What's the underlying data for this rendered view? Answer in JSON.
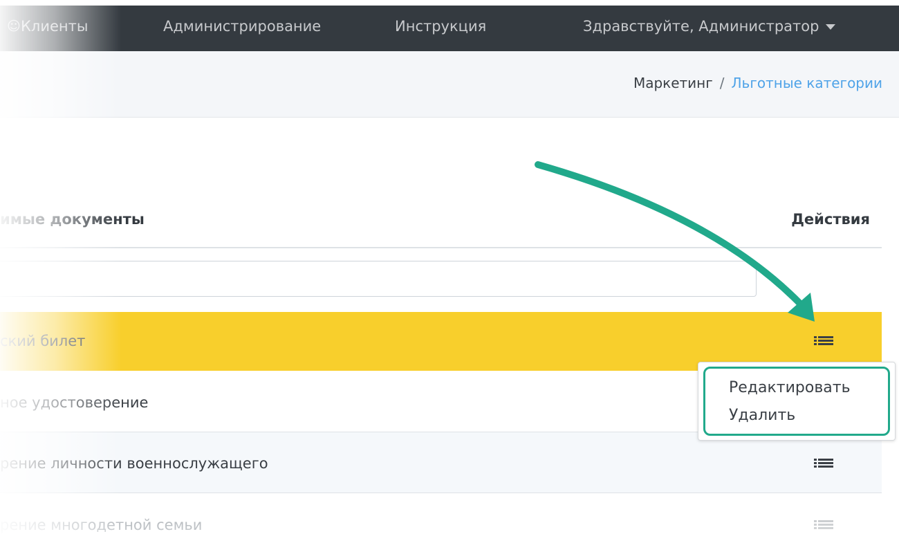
{
  "navbar": {
    "clients": "Клиенты",
    "admin": "Администрирование",
    "help": "Инструкция",
    "greeting": "Здравствуйте, Администратор"
  },
  "breadcrumb": {
    "parent": "Маркетинг",
    "separator": "/",
    "current": "Льготные категории"
  },
  "table": {
    "col_docs": "имые документы",
    "col_actions": "Действия",
    "rows": [
      {
        "label": "ский билет",
        "highlighted": true
      },
      {
        "label": "ное удостоверение"
      },
      {
        "label": "рение личности военнослужащего"
      },
      {
        "label": "рение многодетной семьи"
      }
    ]
  },
  "dropdown": {
    "edit": "Редактировать",
    "delete": "Удалить"
  },
  "colors": {
    "navbar": "#343a40",
    "highlight_row": "#f8cf2c",
    "annotation": "#21a98b",
    "link": "#4fa3e8"
  },
  "icons": [
    "user-icon",
    "caret-down-icon",
    "list-menu-icon",
    "annotation-arrow"
  ]
}
